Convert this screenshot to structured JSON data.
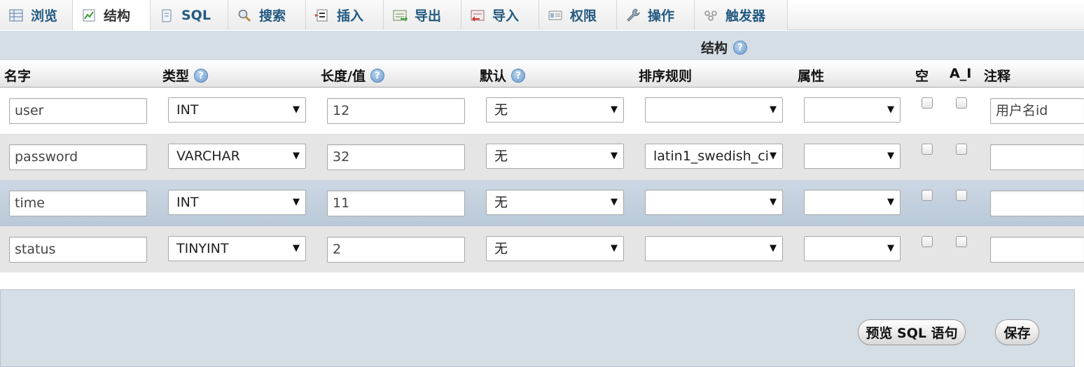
{
  "tabs": [
    {
      "label": "浏览",
      "icon": "table-icon"
    },
    {
      "label": "结构",
      "icon": "structure-icon",
      "active": true
    },
    {
      "label": "SQL",
      "icon": "sql-scroll-icon"
    },
    {
      "label": "搜索",
      "icon": "magnifier-icon"
    },
    {
      "label": "插入",
      "icon": "insert-icon"
    },
    {
      "label": "导出",
      "icon": "export-icon"
    },
    {
      "label": "导入",
      "icon": "import-icon"
    },
    {
      "label": "权限",
      "icon": "privileges-icon"
    },
    {
      "label": "操作",
      "icon": "wrench-icon"
    },
    {
      "label": "触发器",
      "icon": "triggers-icon"
    }
  ],
  "structure": {
    "title": "结构"
  },
  "help_glyph": "?",
  "columns": {
    "name": "名字",
    "type": "类型",
    "length": "长度/值",
    "default": "默认",
    "collation": "排序规则",
    "attributes": "属性",
    "null": "空",
    "ai": "A_I",
    "comment": "注释"
  },
  "select_arrow": "▼",
  "rows": [
    {
      "name": "user",
      "type": "INT",
      "length": "12",
      "default": "无",
      "collation": "",
      "attributes": "",
      "comment": "用户名id"
    },
    {
      "name": "password",
      "type": "VARCHAR",
      "length": "32",
      "default": "无",
      "collation": "latin1_swedish_ci",
      "attributes": "",
      "comment": ""
    },
    {
      "name": "time",
      "type": "INT",
      "length": "11",
      "default": "无",
      "collation": "",
      "attributes": "",
      "comment": ""
    },
    {
      "name": "status",
      "type": "TINYINT",
      "length": "2",
      "default": "无",
      "collation": "",
      "attributes": "",
      "comment": ""
    }
  ],
  "buttons": {
    "preview_sql": "预览 SQL 语句",
    "save": "保存"
  },
  "colors": {
    "tab_text": "#235a81",
    "structure_bar": "#d5dde5",
    "row_hover": "#c3d0de"
  }
}
